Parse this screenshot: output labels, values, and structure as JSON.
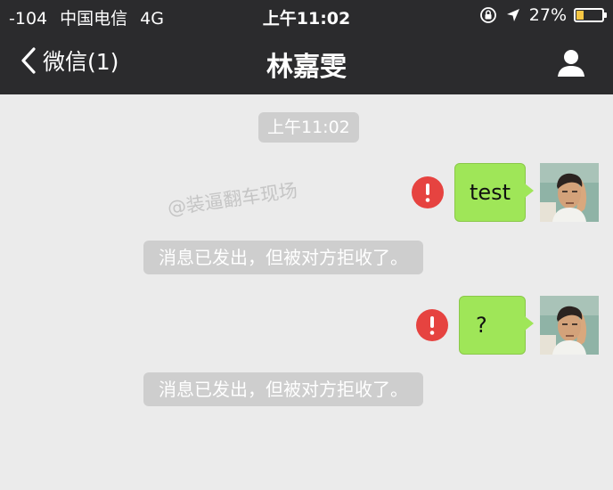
{
  "status_bar": {
    "signal": "-104",
    "carrier": "中国电信",
    "network": "4G",
    "time": "上午11:02",
    "battery": "27%",
    "battery_level": 0.27,
    "lock_icon": "orientation-lock-icon",
    "location_icon": "location-arrow-icon"
  },
  "nav": {
    "back_label": "微信(1)",
    "title": "林嘉雯",
    "back_icon": "chevron-left-icon",
    "profile_icon": "person-icon"
  },
  "chat": {
    "timestamp": "上午11:02",
    "watermark": "@装逼翻车现场",
    "messages": [
      {
        "text": "test",
        "status": "failed",
        "status_icon": "error-exclamation-icon",
        "notice": "消息已发出，但被对方拒收了。"
      },
      {
        "text": "?",
        "status": "failed",
        "status_icon": "error-exclamation-icon",
        "notice": "消息已发出，但被对方拒收了。"
      }
    ]
  },
  "colors": {
    "bar_bg": "#2b2b2d",
    "chat_bg": "#ebebeb",
    "bubble_green": "#9fe658",
    "error_red": "#e64340",
    "pill_gray": "#cecece",
    "battery_yellow": "#f7c744"
  }
}
